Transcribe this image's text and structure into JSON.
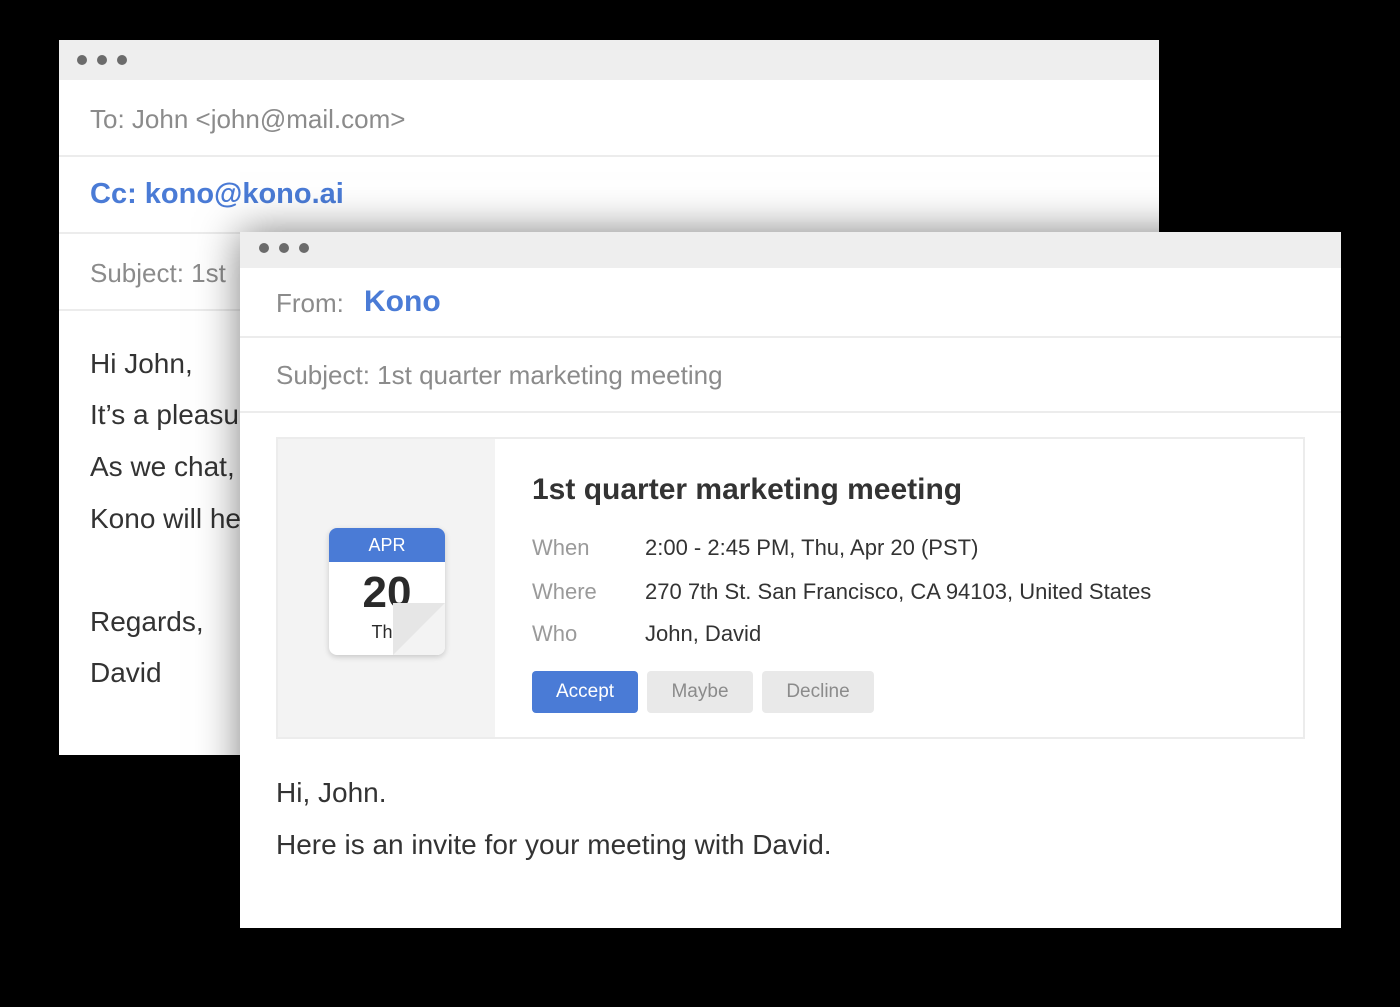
{
  "colors": {
    "accent": "#4a7bd6",
    "muted": "#8b8b8b",
    "text": "#333333"
  },
  "back_window": {
    "to": "To: John <john@mail.com>",
    "cc": "Cc: kono@kono.ai",
    "subject": "Subject:  1st",
    "body": [
      "Hi John,",
      "It’s a pleasu",
      "As we chat,",
      "Kono will he",
      "Regards,",
      "David"
    ]
  },
  "front_window": {
    "from_label": "From:",
    "from_value": "Kono",
    "subject": "Subject: 1st quarter marketing meeting",
    "event": {
      "title": "1st quarter marketing meeting",
      "calendar": {
        "month": "APR",
        "day": "20",
        "weekday": "Thu"
      },
      "details": [
        {
          "label": "When",
          "value": "2:00 - 2:45 PM, Thu, Apr 20 (PST)"
        },
        {
          "label": "Where",
          "value": "270 7th St. San Francisco, CA 94103, United States"
        },
        {
          "label": "Who",
          "value": "John, David"
        }
      ],
      "buttons": {
        "accept": "Accept",
        "maybe": "Maybe",
        "decline": "Decline"
      }
    },
    "body": [
      "Hi, John.",
      "Here is an invite for your meeting with David."
    ]
  }
}
